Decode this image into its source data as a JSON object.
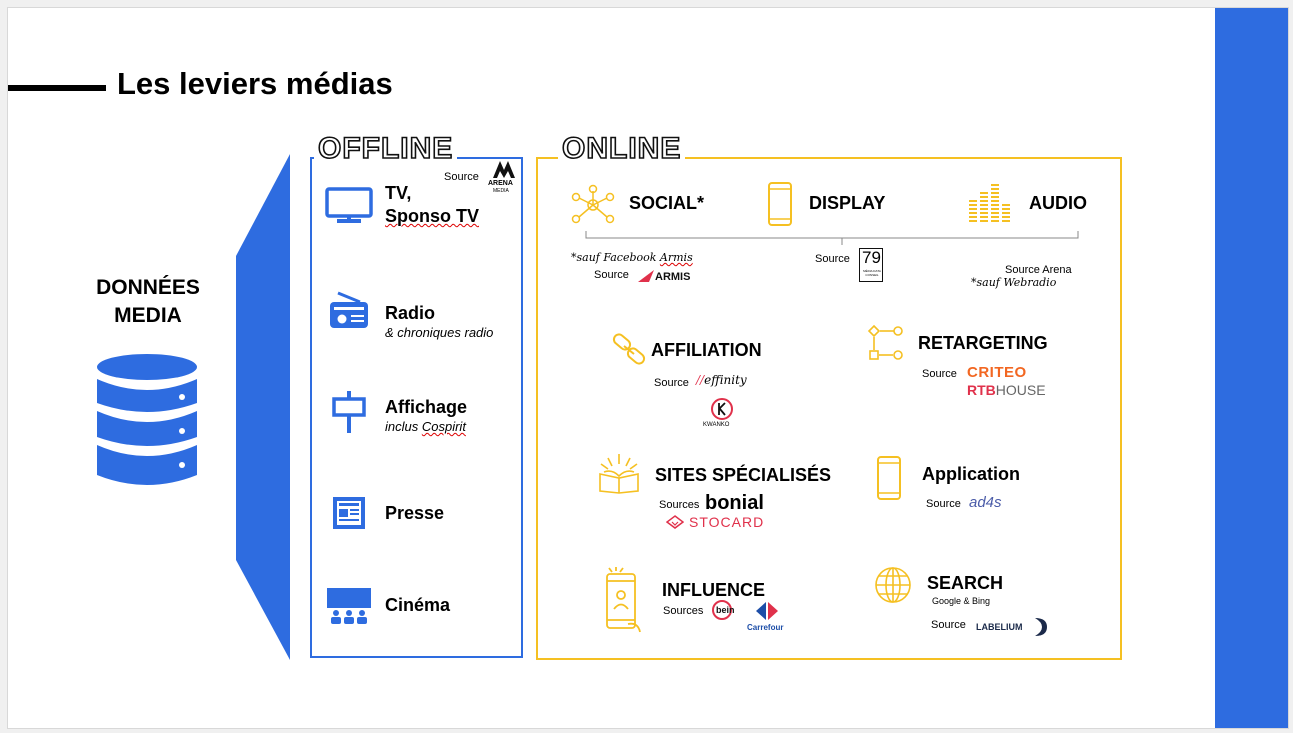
{
  "title": "Les leviers médias",
  "donnees": "DONNÉES\nMEDIA",
  "colors": {
    "blue": "#2e6ce0",
    "yellow": "#f5c022",
    "red": "#e0314b"
  },
  "offline": {
    "heading": "OFFLINE",
    "source_label": "Source",
    "source_logo": "ARENA",
    "source_logo_sub": "MEDIA",
    "items": [
      {
        "icon": "tv-icon",
        "label_line1": "TV,",
        "label_line2": "Sponso TV",
        "sub": ""
      },
      {
        "icon": "radio-icon",
        "label_line1": "Radio",
        "label_line2": "",
        "sub": "& chroniques radio"
      },
      {
        "icon": "billboard-icon",
        "label_line1": "Affichage",
        "label_line2": "",
        "sub_prefix": "inclus ",
        "sub_underlined": "Cospirit"
      },
      {
        "icon": "newspaper-icon",
        "label_line1": "Presse",
        "label_line2": "",
        "sub": ""
      },
      {
        "icon": "cinema-icon",
        "label_line1": "Cinéma",
        "label_line2": "",
        "sub": ""
      }
    ]
  },
  "online": {
    "heading": "ONLINE",
    "social": {
      "label": "SOCIAL*",
      "note_prefix": "*sauf Facebook ",
      "note_underlined": "Armis",
      "source_label": "Source",
      "logo": "ARMIS"
    },
    "display": {
      "label": "DISPLAY",
      "source_label": "Source",
      "logo": "79",
      "logo_sub": "MÉDIA DATA CONSEIL"
    },
    "audio": {
      "label": "AUDIO",
      "source": "Source Arena",
      "note": "*sauf Webradio"
    },
    "affiliation": {
      "label": "AFFILIATION",
      "source_label": "Source",
      "logo1": "effinity",
      "logo2": "KWANKO"
    },
    "retargeting": {
      "label": "RETARGETING",
      "source_label": "Source",
      "logo1": "CRITEO",
      "logo2a": "RTB",
      "logo2b": "HOUSE"
    },
    "sites": {
      "label": "SITES SPÉCIALISÉS",
      "source_label": "Sources",
      "logo1": "bonial",
      "logo2": "STOCARD"
    },
    "application": {
      "label": "Application",
      "source_label": "Source",
      "logo": "ad4s"
    },
    "influence": {
      "label": "INFLUENCE",
      "source_label": "Sources",
      "logo1": "bein",
      "logo2": "Carrefour"
    },
    "search": {
      "label": "SEARCH",
      "sub": "Google & Bing",
      "source_label": "Source",
      "logo": "LABELIUM"
    }
  }
}
